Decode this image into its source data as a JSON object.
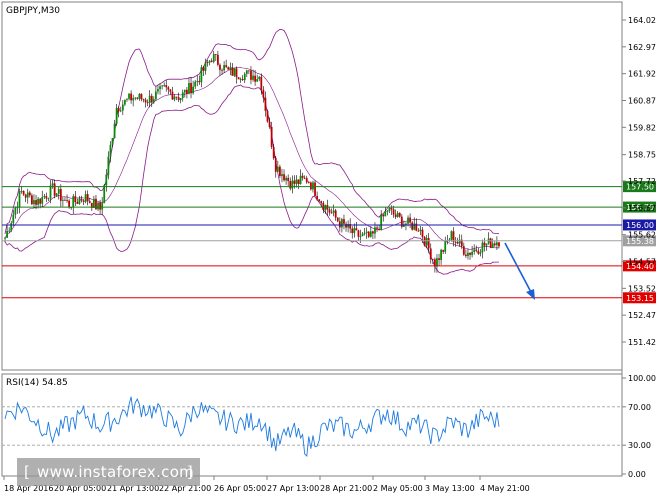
{
  "main_chart": {
    "symbol_label": "GBPJPY,M30",
    "y_ticks": [
      "164.02",
      "162.97",
      "161.92",
      "160.87",
      "159.82",
      "158.75",
      "157.72",
      "156.67",
      "155.62",
      "154.57",
      "153.52",
      "152.47",
      "151.42"
    ],
    "x_ticks": [
      "18 Apr 2016",
      "20 Apr 05:00",
      "21 Apr 13:00",
      "22 Apr 21:00",
      "26 Apr 05:00",
      "27 Apr 13:00",
      "28 Apr 21:00",
      "2 May 05:00",
      "3 May 13:00",
      "4 May 21:00"
    ],
    "levels": [
      {
        "label": "157.50",
        "value": 157.5,
        "color": "#1a7a1a"
      },
      {
        "label": "156.70",
        "value": 156.7,
        "color": "#1a7a1a"
      },
      {
        "label": "156.00",
        "value": 156.0,
        "color": "#1a1aa6"
      },
      {
        "label": "155.38",
        "value": 155.38,
        "color": "#a0a0a0"
      },
      {
        "label": "154.40",
        "value": 154.4,
        "color": "#e00000"
      },
      {
        "label": "153.15",
        "value": 153.15,
        "color": "#e00000"
      }
    ],
    "colors": {
      "up_candle": "#0a8a0a",
      "down_candle": "#c00000",
      "bollinger": "#8a1a8a",
      "arrow": "#1a5fd6"
    }
  },
  "rsi_panel": {
    "label": "RSI(14) 54.85",
    "y_ticks": [
      "100.00",
      "70.00",
      "30.00",
      "0.00"
    ],
    "color": "#1e7be0"
  },
  "watermark": {
    "text": "www.instaforex.com",
    "left_bracket": "[",
    "right_bracket": "]"
  },
  "chart_data": [
    {
      "type": "candlestick",
      "title": "GBPJPY,M30",
      "ylim": [
        150.9,
        164.7
      ],
      "x": [
        "18 Apr 2016",
        "20 Apr 05:00",
        "21 Apr 13:00",
        "22 Apr 21:00",
        "26 Apr 05:00",
        "27 Apr 13:00",
        "28 Apr 21:00",
        "2 May 05:00",
        "3 May 13:00",
        "4 May 21:00"
      ],
      "close_path": [
        155.5,
        157.3,
        156.9,
        157.4,
        156.8,
        157.1,
        156.6,
        160.6,
        161.0,
        160.9,
        161.3,
        161.0,
        161.6,
        162.6,
        162.0,
        161.9,
        161.8,
        158.3,
        157.6,
        157.8,
        156.8,
        156.1,
        155.6,
        155.5,
        156.6,
        156.1,
        155.9,
        154.5,
        155.6,
        154.9,
        155.2,
        155.4
      ],
      "levels": [
        157.5,
        156.7,
        156.0,
        155.38,
        154.4,
        153.15
      ],
      "forecast_target": 153.15,
      "grid": false
    },
    {
      "type": "line",
      "title": "RSI(14) 54.85",
      "ylim": [
        0,
        100
      ],
      "levels": [
        70,
        30
      ],
      "last_value": 54.85
    }
  ]
}
